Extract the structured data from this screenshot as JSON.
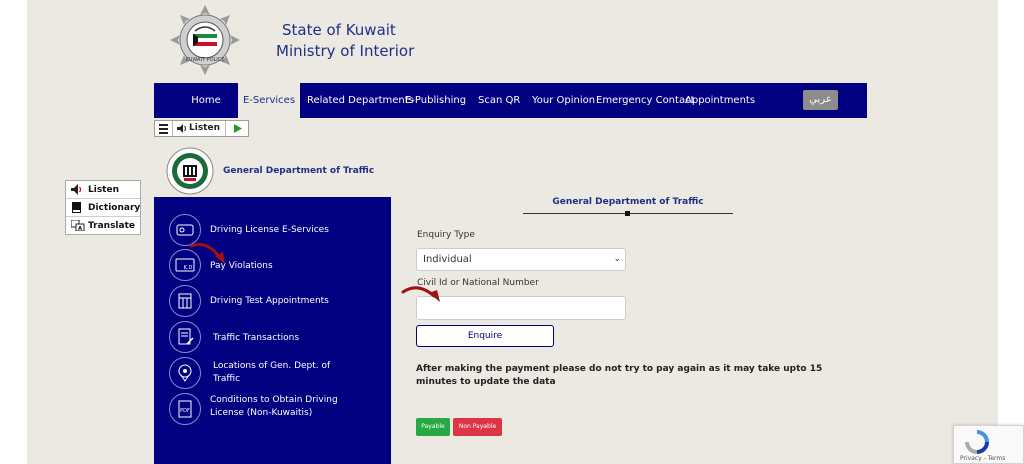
{
  "header": {
    "title_line1": "State of Kuwait",
    "title_line2": "Ministry of Interior",
    "logo_icon": "kuwait-police-star-emblem"
  },
  "nav": {
    "items": [
      {
        "label": "Home",
        "active": false
      },
      {
        "label": "E-Services",
        "active": true
      },
      {
        "label": "Related Departments",
        "active": false
      },
      {
        "label": "E-Publishing",
        "active": false
      },
      {
        "label": "Scan QR",
        "active": false
      },
      {
        "label": "Your Opinion",
        "active": false
      },
      {
        "label": "Emergency Contact",
        "active": false
      },
      {
        "label": "Appointments",
        "active": false
      }
    ],
    "arabic_label": "عربي"
  },
  "listen_bar": {
    "listen_label": "Listen"
  },
  "side_tools": {
    "listen": "Listen",
    "dictionary": "Dictionary",
    "translate": "Translate"
  },
  "department": {
    "title": "General Department of Traffic"
  },
  "sidemenu": {
    "items": [
      {
        "label": "Driving License E-Services",
        "icon": "license-card-icon"
      },
      {
        "label": "Pay Violations",
        "icon": "kd-card-icon"
      },
      {
        "label": "Driving Test Appointments",
        "icon": "calendar-icon"
      },
      {
        "label": "Traffic Transactions",
        "icon": "document-pen-icon"
      },
      {
        "label": "Locations of Gen. Dept. of Traffic",
        "icon": "location-pin-icon"
      },
      {
        "label": "Conditions to Obtain Driving License (Non-Kuwaitis)",
        "icon": "pdf-document-icon"
      }
    ]
  },
  "form": {
    "title": "General Department of Traffic",
    "enquiry_type_label": "Enquiry Type",
    "enquiry_type_value": "Individual",
    "civil_id_label": "Civil Id or National Number",
    "civil_id_value": "",
    "enquire_button": "Enquire",
    "notice": "After making the payment please do not try to pay again as it may take upto 15 minutes to update the data",
    "payable_label": "Payable",
    "non_payable_label": "Non Payable"
  },
  "recaptcha": {
    "links": "Privacy - Terms"
  },
  "colors": {
    "navy": "#000080",
    "page_bg": "#ece9e2",
    "payable": "#28a745",
    "non_payable": "#dc3545",
    "arrow": "#a01010"
  }
}
